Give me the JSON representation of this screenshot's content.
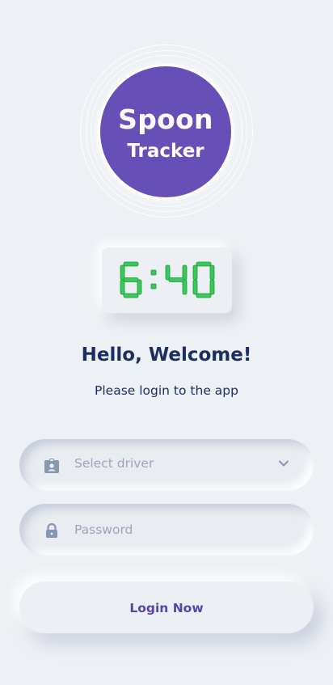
{
  "logo": {
    "line1": "Spoon",
    "line2": "Tracker",
    "circle_color": "#6650b7"
  },
  "clock": {
    "time": "6:40",
    "digit_color": "#39c95a"
  },
  "welcome": {
    "title": "Hello, Welcome!",
    "subtitle": "Please login to the app"
  },
  "form": {
    "driver_select": {
      "placeholder": "Select driver",
      "icon": "contact-badge-icon",
      "dropdown_icon": "chevron-down-icon"
    },
    "password": {
      "placeholder": "Password",
      "icon": "lock-icon"
    },
    "login_label": "Login Now"
  },
  "colors": {
    "background": "#edf0f4",
    "text_primary": "#1b2f63",
    "placeholder": "#9aa6bc",
    "accent": "#5b44ad"
  }
}
